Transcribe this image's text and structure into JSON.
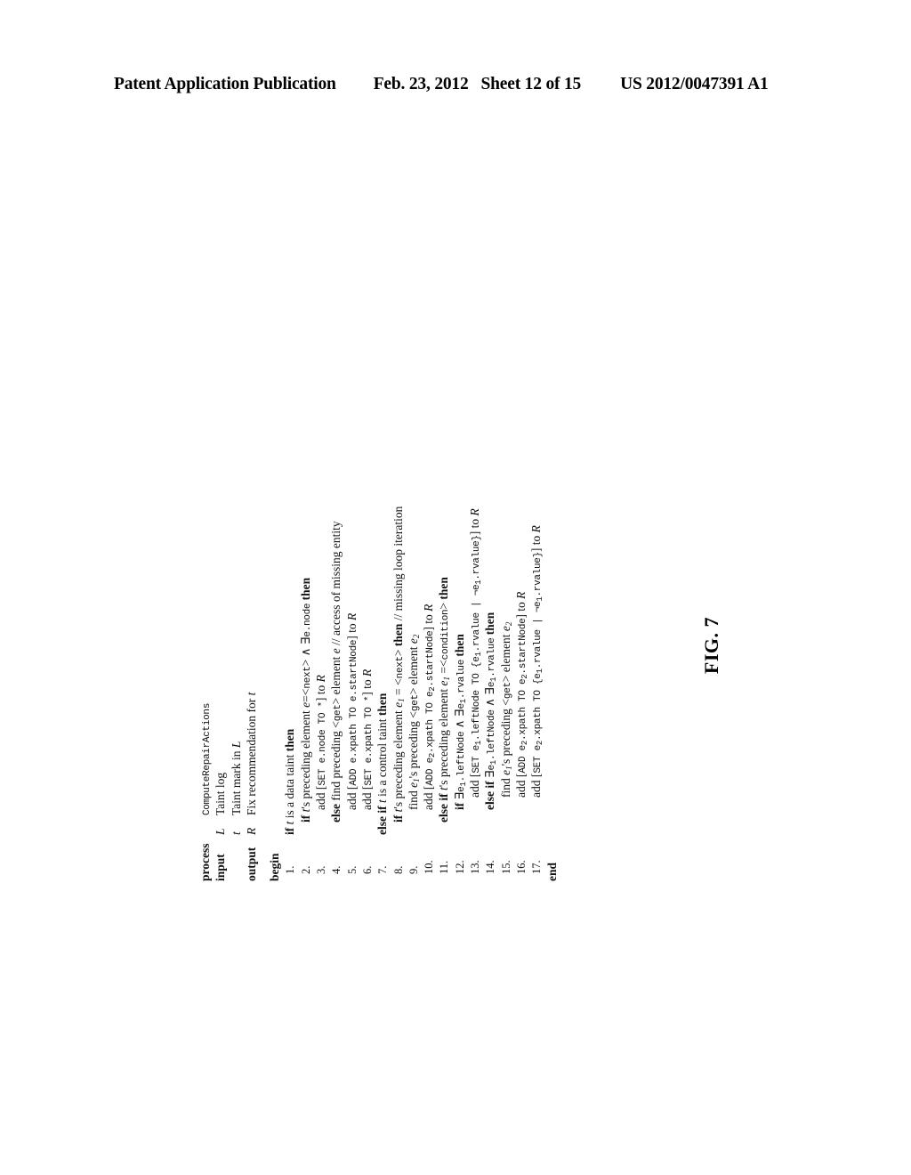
{
  "header": {
    "title": "Patent Application Publication",
    "date": "Feb. 23, 2012",
    "sheet": "Sheet 12 of 15",
    "publication_number": "US 2012/0047391 A1"
  },
  "figure": {
    "label": "FIG. 7",
    "rotation_degrees": -90
  },
  "algorithm": {
    "preamble": [
      {
        "label": "process",
        "symbol": "",
        "text_plain": "ComputeRepairActions",
        "text_html": "<span class=\"mono\">ComputeRepairActions</span>"
      },
      {
        "label": "input",
        "symbol": "L",
        "text_plain": "Taint log",
        "text_html": "Taint log"
      },
      {
        "label": "",
        "symbol": "t",
        "text_plain": "Taint mark in L",
        "text_html": "Taint mark in <span class=\"cal\">L</span>"
      },
      {
        "label": "output",
        "symbol": "R",
        "text_plain": "Fix recommendation for t",
        "text_html": "Fix recommendation for <span class=\"it\">t</span>"
      }
    ],
    "begin_label": "begin",
    "end_label": "end",
    "lines": [
      {
        "number": "1.",
        "indent": 0,
        "text_plain": "if t is a data taint then",
        "text_html": "<span class=\"kw\">if</span> <span class=\"it\">t</span> is a data taint <span class=\"kw\">then</span>"
      },
      {
        "number": "2.",
        "indent": 1,
        "text_plain": "if t's preceding element e=<next> ∧ ∃e.node then",
        "text_html": "<span class=\"kw\">if</span> <span class=\"it\">t</span>'s preceding element <span class=\"it\">e</span>=&lt;<span class=\"mono\">next</span>&gt; ∧ ∃<span class=\"mono\">e.node</span> <span class=\"kw\">then</span>"
      },
      {
        "number": "3.",
        "indent": 2,
        "text_plain": "add [SET e.node TO *] to R",
        "text_html": "add [<span class=\"mono\">SET e.node TO *</span>] to <span class=\"cal\">R</span>"
      },
      {
        "number": "4.",
        "indent": 1,
        "text_plain": "else find preceding <get> element e // access of missing entity",
        "text_html": "<span class=\"kw\">else</span> find preceding &lt;<span class=\"mono\">get</span>&gt; element <span class=\"it\">e</span> <span class=\"cmt\">// access of missing entity</span>"
      },
      {
        "number": "5.",
        "indent": 2,
        "text_plain": "add [ADD e.xpath TO e.startNode] to R",
        "text_html": "add [<span class=\"mono\">ADD e.xpath TO e.startNode</span>] to <span class=\"cal\">R</span>"
      },
      {
        "number": "6.",
        "indent": 2,
        "text_plain": "add [SET e.xpath TO *] to R",
        "text_html": "add [<span class=\"mono\">SET e.xpath TO *</span>] to <span class=\"cal\">R</span>"
      },
      {
        "number": "7.",
        "indent": 0,
        "text_plain": "else if t is a control taint then",
        "text_html": "<span class=\"kw\">else if</span> <span class=\"it\">t</span> is a control taint <span class=\"kw\">then</span>"
      },
      {
        "number": "8.",
        "indent": 1,
        "text_plain": "if t's preceding element e₁ = <next> then // missing loop iteration",
        "text_html": "<span class=\"kw\">if</span> <span class=\"it\">t</span>'s preceding element <span class=\"it\">e<span class=\"sub\">1</span></span> = &lt;<span class=\"mono\">next</span>&gt; <span class=\"kw\">then</span> <span class=\"cmt\">// missing loop iteration</span>"
      },
      {
        "number": "9.",
        "indent": 2,
        "text_plain": "find e₁'s preceding <get> element e₂",
        "text_html": "find <span class=\"it\">e<span class=\"sub\">1</span></span>'s preceding &lt;<span class=\"mono\">get</span>&gt; element <span class=\"it\">e<span class=\"sub\">2</span></span>"
      },
      {
        "number": "10.",
        "indent": 2,
        "text_plain": "add [ADD e₂.xpath TO e₂.startNode] to R",
        "text_html": "add [<span class=\"mono\">ADD e<span class=\"sub\">2</span>.xpath TO e<span class=\"sub\">2</span>.startNode</span>] to <span class=\"cal\">R</span>"
      },
      {
        "number": "11.",
        "indent": 1,
        "text_plain": "else if t's preceding element e₁ =<condition> then",
        "text_html": "<span class=\"kw\">else if</span> <span class=\"it\">t</span>'s preceding element <span class=\"it\">e<span class=\"sub\">1</span></span> =&lt;<span class=\"mono\">condition</span>&gt; <span class=\"kw\">then</span>"
      },
      {
        "number": "12.",
        "indent": 2,
        "text_plain": "if ∃e₁.leftNode ∧ ∃e₁.rvalue then",
        "text_html": "<span class=\"kw\">if</span> ∃<span class=\"mono\">e<span class=\"sub\">1</span>.leftNode</span> ∧ ∃<span class=\"mono\">e<span class=\"sub\">1</span>.rvalue</span> <span class=\"kw\">then</span>"
      },
      {
        "number": "13.",
        "indent": 3,
        "text_plain": "add [SET e₁.leftNode TO {e₁.rvalue | ¬e₁.rvalue}] to R",
        "text_html": "add [<span class=\"mono\">SET e<span class=\"sub\">1</span>.leftNode TO {e<span class=\"sub\">1</span>.rvalue | ¬e<span class=\"sub\">1</span>.rvalue}</span>] to <span class=\"cal\">R</span>"
      },
      {
        "number": "14.",
        "indent": 2,
        "text_plain": "else if ∃e₁.leftNode ∧ ∃e₁.rvalue then",
        "text_html": "<span class=\"kw\">else if</span> ∃<span class=\"mono\">e<span class=\"sub\">1</span>.leftNode</span> ∧ ∃<span class=\"mono\">e<span class=\"sub\">1</span>.rvalue</span> <span class=\"kw\">then</span>"
      },
      {
        "number": "15.",
        "indent": 3,
        "text_plain": "find e₁'s preceding <get> element e₂",
        "text_html": "find <span class=\"it\">e<span class=\"sub\">1</span></span>'s preceding &lt;<span class=\"mono\">get</span>&gt; element <span class=\"it\">e<span class=\"sub\">2</span></span>"
      },
      {
        "number": "16.",
        "indent": 3,
        "text_plain": "add [ADD e₂.xpath TO e₂.startNode] to R",
        "text_html": "add [<span class=\"mono\">ADD e<span class=\"sub\">2</span>.xpath TO e<span class=\"sub\">2</span>.startNode</span>] to <span class=\"cal\">R</span>"
      },
      {
        "number": "17.",
        "indent": 3,
        "text_plain": "add [SET e₂.xpath TO {e₁.rvalue | ¬e₁.rvalue}] to R",
        "text_html": "add [<span class=\"mono\">SET e<span class=\"sub\">2</span>.xpath TO {e<span class=\"sub\">1</span>.rvalue | ¬e<span class=\"sub\">1</span>.rvalue}</span>] to <span class=\"cal\">R</span>"
      }
    ]
  }
}
